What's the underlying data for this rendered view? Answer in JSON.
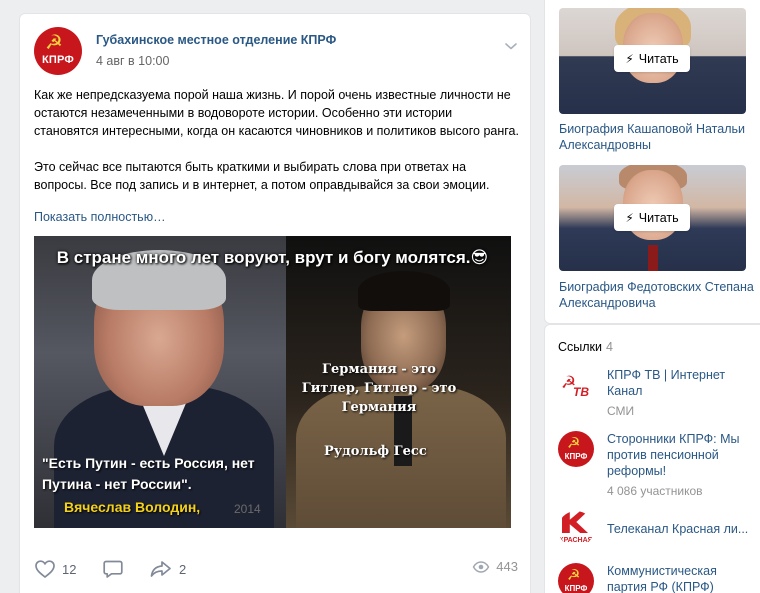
{
  "post": {
    "author": "Губахинское местное отделение КПРФ",
    "date": "4 авг в 10:00",
    "avatar_label": "КПРФ",
    "text_p1": "Как же непредсказуема порой наша жизнь. И порой очень известные личности не остаются незамеченными в водовороте истории. Особенно эти истории становятся интересными, когда он касаются чиновников и политиков высого ранга.",
    "text_p2": "Это сейчас все пытаются быть краткими и выбирать слова при ответах на вопросы. Все под запись и в интернет, а потом оправдывайся за свои эмоции.",
    "show_more": "Показать полностью…",
    "image": {
      "caption_top": "В стране много лет воруют, врут и богу молятся.😎",
      "caption_germany": "Германия - это Гитлер, Гитлер - это Германия",
      "caption_name_right": "Рудольф Гесс",
      "caption_quote": "\"Есть Путин - есть Россия, нет Путина - нет России\".",
      "caption_name_left": "Вячеслав Володин,",
      "caption_year": "2014"
    },
    "actions": {
      "likes": "12",
      "shares": "2",
      "views": "443"
    },
    "icons": [
      "kprf-logo",
      "chevron-down-icon",
      "heart-icon",
      "comment-icon",
      "share-icon",
      "eye-icon"
    ]
  },
  "sidebar": {
    "read_label": "Читать",
    "articles": [
      {
        "title": "Биография Кашаповой Натальи Александровны"
      },
      {
        "title": "Биография Федотовских Степана Александровича"
      }
    ],
    "links_title": "Ссылки",
    "links_count": "4",
    "links": [
      {
        "name": "КПРФ ТВ | Интернет Канал",
        "sub": "СМИ",
        "icon_label": "ТВ"
      },
      {
        "name": "Сторонники КПРФ: Мы против пенсионной реформы!",
        "sub": "4 086 участников",
        "icon_label": "КПРФ"
      },
      {
        "name": "Телеканал Красная ли...",
        "sub": "",
        "icon_label": "КРАСНАЯ"
      },
      {
        "name": "Коммунистическая партия РФ (КПРФ)",
        "sub": "",
        "icon_label": "КПРФ"
      }
    ]
  },
  "colors": {
    "link": "#2a5885",
    "background": "#edeef0",
    "kprf_red": "#c8161d",
    "muted": "#828282"
  }
}
